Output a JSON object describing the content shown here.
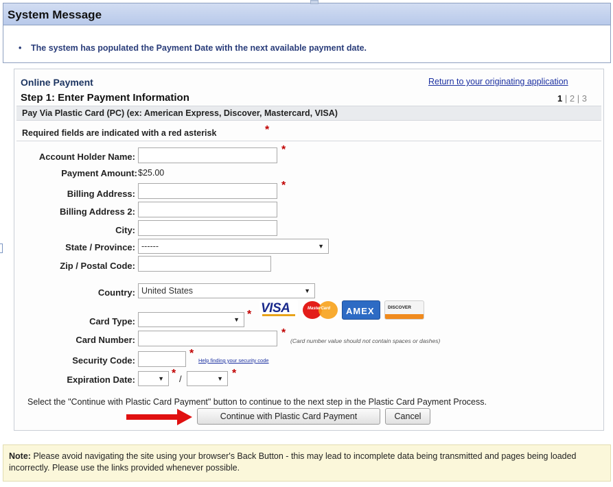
{
  "system_message": {
    "title": "System Message",
    "bullet": "•",
    "text": "The system has populated the Payment Date with the next available payment date."
  },
  "header": {
    "section": "Online Payment",
    "return_link": "Return to your originating application",
    "step_title": "Step 1: Enter Payment Information",
    "steps": {
      "current": "1",
      "sep1": "|",
      "two": "2",
      "sep2": "|",
      "three": "3"
    },
    "pay_via": "Pay Via Plastic Card (PC) (ex: American Express, Discover, Mastercard, VISA)",
    "required_note": "Required fields are indicated with a red asterisk",
    "asterisk": "*"
  },
  "form": {
    "account_holder_label": "Account Holder Name:",
    "payment_amount_label": "Payment Amount:",
    "payment_amount_value": "$25.00",
    "billing_address_label": "Billing Address:",
    "billing_address2_label": "Billing Address 2:",
    "city_label": "City:",
    "state_label": "State / Province:",
    "state_value": "------",
    "zip_label": "Zip / Postal Code:",
    "country_label": "Country:",
    "country_value": "United States",
    "card_type_label": "Card Type:",
    "card_type_value": "",
    "card_number_label": "Card Number:",
    "card_number_hint": "(Card number value should not contain spaces or dashes)",
    "security_code_label": "Security Code:",
    "security_help_link": "Help finding your security code",
    "expiration_label": "Expiration Date:",
    "expiration_sep": "/",
    "instructions": "Select the \"Continue with Plastic Card Payment\" button to continue to the next step in the Plastic Card Payment Process."
  },
  "cards": {
    "visa": "VISA",
    "mastercard": "MasterCard",
    "amex": "AMEX",
    "discover": "DISCOVER"
  },
  "buttons": {
    "continue": "Continue with Plastic Card Payment",
    "cancel": "Cancel"
  },
  "note": {
    "label": "Note:",
    "text": "Please avoid navigating the site using your browser's Back Button - this may lead to incomplete data being transmitted and pages being loaded incorrectly. Please use the links provided whenever possible."
  },
  "colors": {
    "header_blue": "#b8c9ea",
    "message_text": "#2a3d7a",
    "link": "#1a2fa0",
    "asterisk": "#c00000",
    "arrow": "#e01010",
    "note_bg": "#fbf7da"
  }
}
